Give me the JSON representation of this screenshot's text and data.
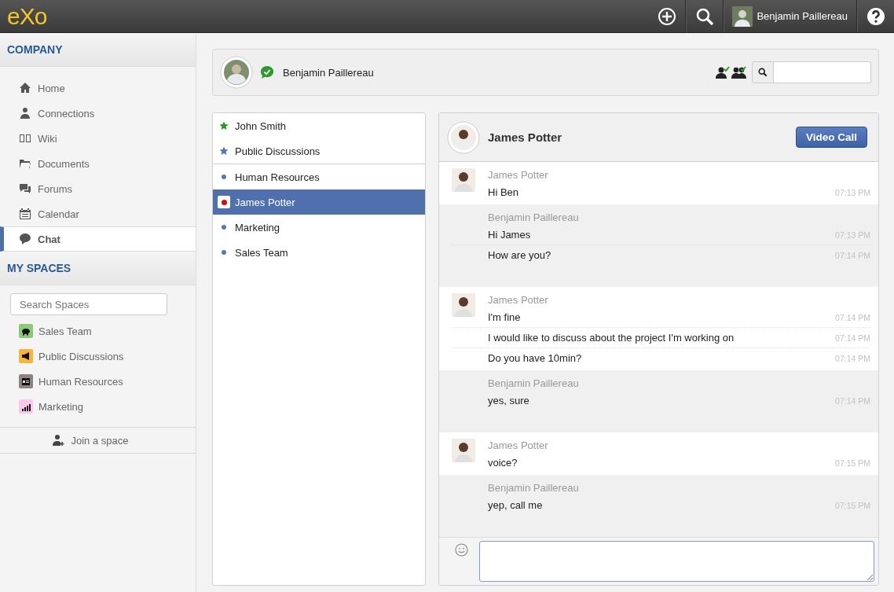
{
  "top_bar": {
    "logo": "eXo",
    "user_name": "Benjamin Paillereau"
  },
  "sidebar": {
    "company_title": "COMPANY",
    "nav_items": [
      {
        "label": "Home",
        "selected": false
      },
      {
        "label": "Connections",
        "selected": false
      },
      {
        "label": "Wiki",
        "selected": false
      },
      {
        "label": "Documents",
        "selected": false
      },
      {
        "label": "Forums",
        "selected": false
      },
      {
        "label": "Calendar",
        "selected": false
      },
      {
        "label": "Chat",
        "selected": true
      }
    ],
    "spaces_title": "MY SPACES",
    "search": {
      "placeholder": "Search Spaces"
    },
    "spaces": [
      {
        "label": "Sales Team",
        "color": "#8cc97a"
      },
      {
        "label": "Public Discussions",
        "color": "#f7b43a"
      },
      {
        "label": "Human Resources",
        "color": "#8d8382"
      },
      {
        "label": "Marketing",
        "color": "#f9c6ec"
      }
    ],
    "join_label": "Join a space"
  },
  "user_header": {
    "name": "Benjamin Paillereau"
  },
  "rooms": [
    {
      "kind": "favorite",
      "label": "John Smith",
      "color": "#239b23",
      "selected": false
    },
    {
      "kind": "favorite",
      "label": "Public Discussions",
      "color": "#5577b5",
      "selected": false
    },
    {
      "kind": "room",
      "label": "Human Resources",
      "color": "#5577b5",
      "selected": false
    },
    {
      "kind": "room",
      "label": "James Potter",
      "color": "#cc1111",
      "selected": true
    },
    {
      "kind": "room",
      "label": "Marketing",
      "color": "#5577b5",
      "selected": false
    },
    {
      "kind": "room",
      "label": "Sales Team",
      "color": "#5577b5",
      "selected": false
    }
  ],
  "chat": {
    "title": "James Potter",
    "video_call": "Video Call",
    "groups": [
      {
        "kind": "other",
        "sender": "James Potter",
        "messages": [
          {
            "text": "Hi Ben",
            "time": "07:13 PM"
          }
        ]
      },
      {
        "kind": "self",
        "sender": "Benjamin Paillereau",
        "messages": [
          {
            "text": "Hi James",
            "time": "07:13 PM"
          },
          {
            "text": "How are you?",
            "time": "07:14 PM"
          }
        ]
      },
      {
        "kind": "other",
        "sender": "James Potter",
        "messages": [
          {
            "text": "I'm fine",
            "time": "07:14 PM"
          },
          {
            "text": "I would like to discuss about the project I'm working on",
            "time": "07:14 PM"
          },
          {
            "text": "Do you have 10min?",
            "time": "07:14 PM"
          }
        ]
      },
      {
        "kind": "self",
        "sender": "Benjamin Paillereau",
        "messages": [
          {
            "text": "yes, sure",
            "time": "07:14 PM"
          }
        ]
      },
      {
        "kind": "other",
        "sender": "James Potter",
        "messages": [
          {
            "text": "voice?",
            "time": "07:15 PM"
          }
        ]
      },
      {
        "kind": "self",
        "sender": "Benjamin Paillereau",
        "messages": [
          {
            "text": "yep, call me",
            "time": "07:15 PM"
          }
        ]
      }
    ]
  }
}
